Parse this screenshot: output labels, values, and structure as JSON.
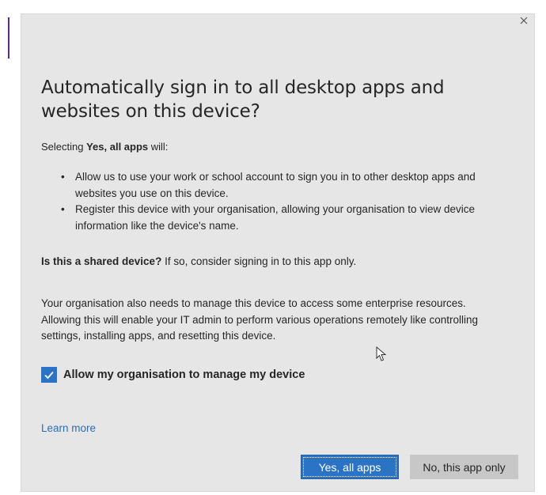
{
  "dialog": {
    "close_icon": "close-icon",
    "title": "Automatically sign in to all desktop apps and websites on this device?",
    "intro": {
      "prefix": "Selecting ",
      "bold": "Yes, all apps",
      "suffix": " will:"
    },
    "bullets": [
      "Allow us to use your work or school account to sign you in to other desktop apps and websites you use on this device.",
      "Register this device with your organisation, allowing your organisation to view device information like the device's name."
    ],
    "shared_question": {
      "bold": "Is this a shared device?",
      "rest": " If so, consider signing in to this app only."
    },
    "manage_paragraph": "Your organisation also needs to manage this device to access some enterprise resources. Allowing this will enable your IT admin to perform various operations remotely like controlling settings, installing apps, and resetting this device.",
    "manage_checkbox": {
      "label": "Allow my organisation to manage my device",
      "checked": true
    },
    "learn_more": "Learn more",
    "buttons": {
      "primary": "Yes, all apps",
      "secondary": "No, this app only"
    }
  },
  "colors": {
    "dialog_background": "#e6e6e6",
    "accent": "#2b73c4",
    "link": "#2e6db4",
    "secondary_button": "#c7c7c7"
  }
}
